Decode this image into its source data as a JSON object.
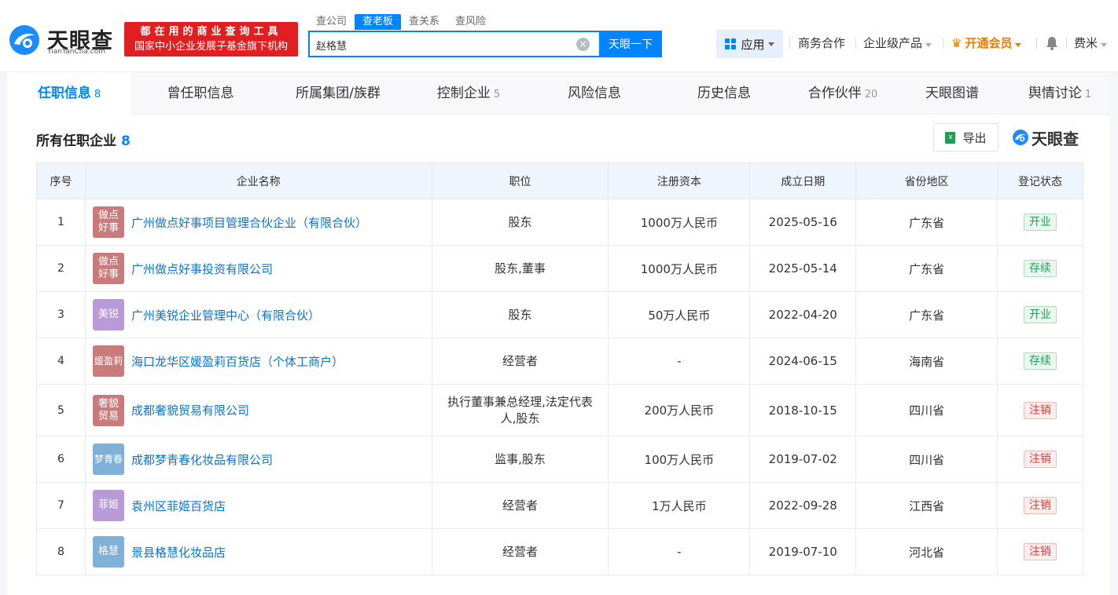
{
  "header": {
    "logo_text": "天眼查",
    "logo_sub": "TianYanCha.com",
    "promo_line1": "都在用的商业查询工具",
    "promo_line2": "国家中小企业发展子基金旗下机构",
    "search_tabs": [
      "查公司",
      "查老板",
      "查关系",
      "查风险"
    ],
    "search_value": "赵格慧",
    "search_button": "天眼一下",
    "app_label": "应用",
    "nav": {
      "business": "商务合作",
      "enterprise": "企业级产品",
      "vip": "开通会员",
      "user": "费米"
    }
  },
  "tabs": [
    {
      "label": "任职信息",
      "count": "8"
    },
    {
      "label": "曾任职信息",
      "count": ""
    },
    {
      "label": "所属集团/族群",
      "count": ""
    },
    {
      "label": "控制企业",
      "count": "5"
    },
    {
      "label": "风险信息",
      "count": ""
    },
    {
      "label": "历史信息",
      "count": ""
    },
    {
      "label": "合作伙伴",
      "count": "20"
    },
    {
      "label": "天眼图谱",
      "count": ""
    },
    {
      "label": "舆情讨论",
      "count": "1"
    }
  ],
  "section": {
    "title": "所有任职企业",
    "count": "8",
    "export_label": "导出",
    "brand": "天眼查"
  },
  "table": {
    "columns": [
      "序号",
      "企业名称",
      "职位",
      "注册资本",
      "成立日期",
      "省份地区",
      "登记状态"
    ],
    "rows": [
      {
        "index": "1",
        "logo_text": "做点好事",
        "logo_color": "#c97b7b",
        "name": "广州做点好事项目管理合伙企业（有限合伙）",
        "position": "股东",
        "capital": "1000万人民币",
        "date": "2025-05-16",
        "region": "广东省",
        "status": "开业",
        "status_color": "green"
      },
      {
        "index": "2",
        "logo_text": "做点好事",
        "logo_color": "#c97b7b",
        "name": "广州做点好事投资有限公司",
        "position": "股东,董事",
        "capital": "1000万人民币",
        "date": "2025-05-14",
        "region": "广东省",
        "status": "存续",
        "status_color": "green"
      },
      {
        "index": "3",
        "logo_text": "美锐",
        "logo_color": "#b79ad6",
        "name": "广州美锐企业管理中心（有限合伙）",
        "position": "股东",
        "capital": "50万人民币",
        "date": "2022-04-20",
        "region": "广东省",
        "status": "开业",
        "status_color": "green"
      },
      {
        "index": "4",
        "logo_text": "媛盈莉",
        "logo_color": "#c97b7b",
        "name": "海口龙华区媛盈莉百货店（个体工商户）",
        "position": "经营者",
        "capital": "-",
        "date": "2024-06-15",
        "region": "海南省",
        "status": "存续",
        "status_color": "green"
      },
      {
        "index": "5",
        "logo_text": "奢貌贸易",
        "logo_color": "#c97b7b",
        "name": "成都奢貌贸易有限公司",
        "position": "执行董事兼总经理,法定代表人,股东",
        "capital": "200万人民币",
        "date": "2018-10-15",
        "region": "四川省",
        "status": "注销",
        "status_color": "red"
      },
      {
        "index": "6",
        "logo_text": "梦青春",
        "logo_color": "#7fb0d8",
        "name": "成都梦青春化妆品有限公司",
        "position": "监事,股东",
        "capital": "100万人民币",
        "date": "2019-07-02",
        "region": "四川省",
        "status": "注销",
        "status_color": "red"
      },
      {
        "index": "7",
        "logo_text": "菲姬",
        "logo_color": "#b79ad6",
        "name": "袁州区菲姬百货店",
        "position": "经营者",
        "capital": "1万人民币",
        "date": "2022-09-28",
        "region": "江西省",
        "status": "注销",
        "status_color": "red"
      },
      {
        "index": "8",
        "logo_text": "格慧",
        "logo_color": "#7fb0d8",
        "name": "景县格慧化妆品店",
        "position": "经营者",
        "capital": "-",
        "date": "2019-07-10",
        "region": "河北省",
        "status": "注销",
        "status_color": "red"
      }
    ]
  }
}
